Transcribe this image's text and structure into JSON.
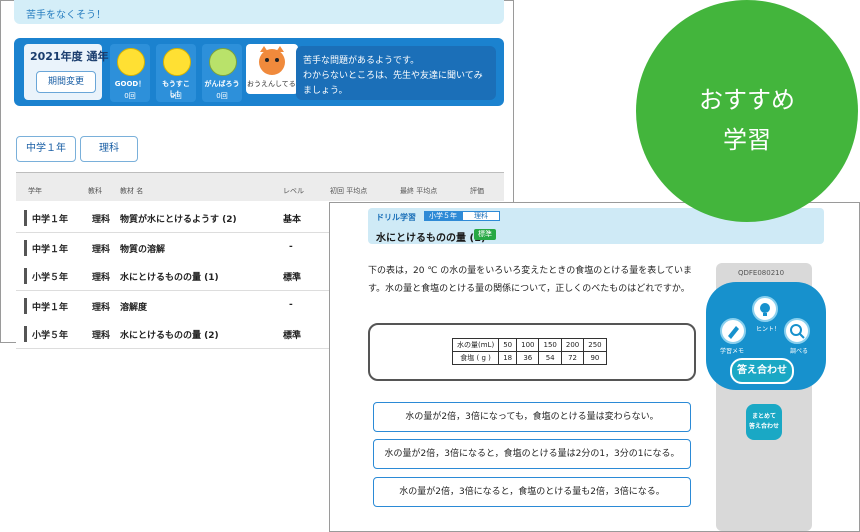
{
  "back": {
    "banner": "苦手をなくそう！",
    "year_label": "2021年度 通年",
    "period_button": "期間変更",
    "faces": [
      {
        "label": "GOOD！",
        "count": "0回"
      },
      {
        "label": "もうすこし！",
        "count": "0回"
      },
      {
        "label": "がんばろう",
        "count": "0回"
      }
    ],
    "mascot_label": "おうえんしてるよ",
    "speech_line1": "苦手な問題があるようです。",
    "speech_line2": "わからないところは、先生や友達に聞いてみましょう。",
    "tabs": [
      "中学１年",
      "理科"
    ],
    "headers": [
      "学年",
      "教科",
      "教材 名",
      "レベル",
      "初回 平均点",
      "最終 平均点",
      "評価"
    ],
    "rows": [
      {
        "grade": "中学１年",
        "subject": "理科",
        "name": "物質が水にとけるようす (2)",
        "level": "基本"
      },
      {
        "grade": "中学１年",
        "subject": "理科",
        "name": "物質の溶解",
        "level": "-"
      },
      {
        "grade": "小学５年",
        "subject": "理科",
        "name": "水にとけるものの量 (1)",
        "level": "標準"
      },
      {
        "grade": "中学１年",
        "subject": "理科",
        "name": "溶解度",
        "level": "-"
      },
      {
        "grade": "小学５年",
        "subject": "理科",
        "name": "水にとけるものの量 (2)",
        "level": "標準"
      }
    ]
  },
  "front": {
    "drill": "ドリル学習",
    "grade": "小学５年",
    "subject": "理科",
    "title": "水にとけるものの量 (1)",
    "level": "標準",
    "question": "下の表は，20 ℃ の水の量をいろいろ変えたときの食塩のとける量を表しています。水の量と食塩のとける量の関係について，正しくのべたものはどれですか。",
    "table_row1": [
      "水の量(mL)",
      "50",
      "100",
      "150",
      "200",
      "250"
    ],
    "table_row2": [
      "食塩 ( g )",
      "18",
      "36",
      "54",
      "72",
      "90"
    ],
    "choices": [
      "水の量が2倍，3倍になっても，食塩のとける量は変わらない。",
      "水の量が2倍，3倍になると，食塩のとける量は2分の1，3分の1になる。",
      "水の量が2倍，3倍になると，食塩のとける量も2倍，3倍になる。"
    ],
    "question_id": "QDFE080210",
    "hint": "ヒント！",
    "memo": "学習メモ",
    "search": "調べる",
    "answer": "答え合わせ",
    "batch_line1": "まとめて",
    "batch_line2": "答え合わせ"
  },
  "badge": {
    "line1": "おすすめ",
    "line2": "学習",
    "color": "#43b53c"
  }
}
